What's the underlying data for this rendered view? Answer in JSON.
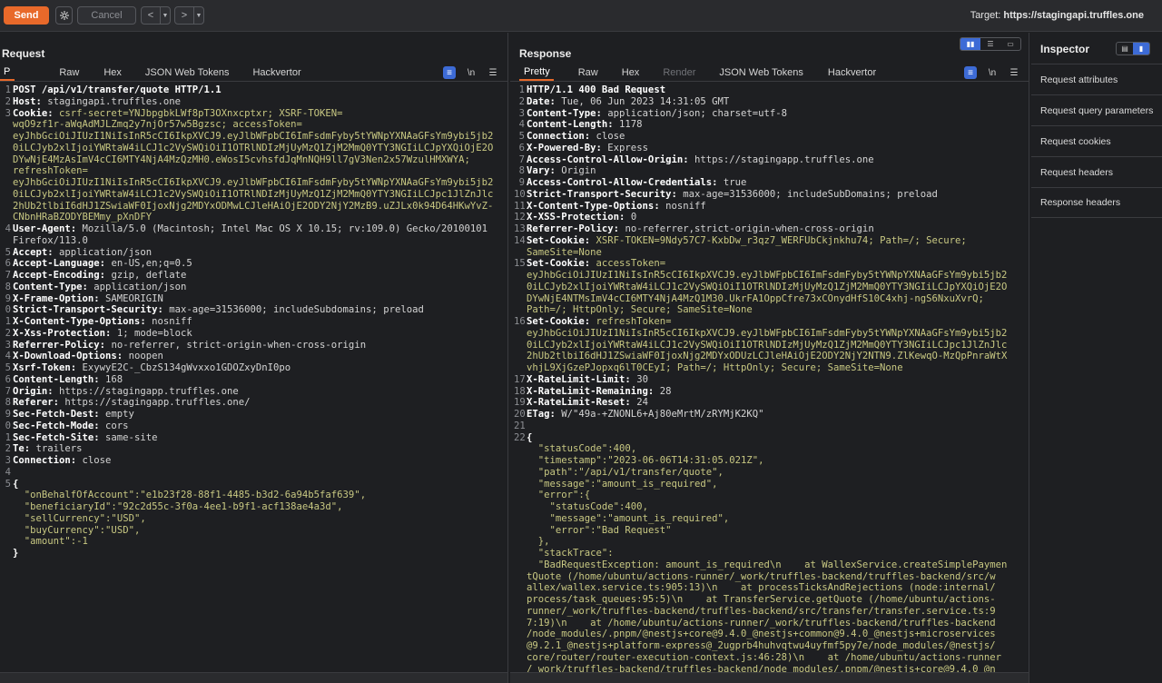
{
  "toolbar": {
    "send_label": "Send",
    "cancel_label": "Cancel",
    "back_label": "<",
    "forward_label": ">",
    "target_prefix": "Target: ",
    "target_url": "https://stagingapi.truffles.one"
  },
  "request": {
    "title": "Request",
    "tabs": [
      "P",
      "Raw",
      "Hex",
      "JSON Web Tokens",
      "Hackvertor"
    ],
    "newline_label": "\\n",
    "lines": [
      {
        "n": "1",
        "t": "POST /api/v1/transfer/quote HTTP/1.1"
      },
      {
        "n": "2",
        "h": "Host:",
        "v": " stagingapi.truffles.one"
      },
      {
        "n": "3",
        "h": "Cookie:",
        "v": " csrf-secret=YNJbpgbkLWf8pT3OXnxcptxr; XSRF-TOKEN=\nwqO9zf1r-aWqAdMJLZmq2y7njOr57w5Bgzsc; accessToken=\neyJhbGciOiJIUzI1NiIsInR5cCI6IkpXVCJ9.eyJlbWFpbCI6ImFsdmFyby5tYWNpYXNAaGFsYm9ybi5jb2\n0iLCJyb2xlIjoiYWRtaW4iLCJ1c2VySWQiOiI1OTRlNDIzMjUyMzQ1ZjM2MmQ0YTY3NGIiLCJpYXQiOjE2O\nDYwNjE4MzAsImV4cCI6MTY4NjA4MzQzMH0.eWosI5cvhsfdJqMnNQH9ll7gV3Nen2x57WzulHMXWYA;\nrefreshToken=\neyJhbGciOiJIUzI1NiIsInR5cCI6IkpXVCJ9.eyJlbWFpbCI6ImFsdmFyby5tYWNpYXNAaGFsYm9ybi5jb2\n0iLCJyb2xlIjoiYWRtaW4iLCJ1c2VySWQiOiI1OTRlNDIzMjUyMzQ1ZjM2MmQ0YTY3NGIiLCJpc1JlZnJlc\n2hUb2tlbiI6dHJ1ZSwiaWF0IjoxNjg2MDYxODMwLCJleHAiOjE2ODY2NjY2MzB9.uZJLx0k94D64HKwYvZ-\nCNbnHRaBZODYBEMmy_pXnDFY"
      },
      {
        "n": "4",
        "h": "User-Agent:",
        "v": " Mozilla/5.0 (Macintosh; Intel Mac OS X 10.15; rv:109.0) Gecko/20100101\nFirefox/113.0"
      },
      {
        "n": "5",
        "h": "Accept:",
        "v": " application/json"
      },
      {
        "n": "6",
        "h": "Accept-Language:",
        "v": " en-US,en;q=0.5"
      },
      {
        "n": "7",
        "h": "Accept-Encoding:",
        "v": " gzip, deflate"
      },
      {
        "n": "8",
        "h": "Content-Type:",
        "v": " application/json"
      },
      {
        "n": "9",
        "h": "X-Frame-Option:",
        "v": " SAMEORIGIN"
      },
      {
        "n": "0",
        "h": "Strict-Transport-Security:",
        "v": " max-age=31536000; includeSubdomains; preload"
      },
      {
        "n": "1",
        "h": "X-Content-Type-Options:",
        "v": " nosniff"
      },
      {
        "n": "2",
        "h": "X-Xss-Protection:",
        "v": " 1; mode=block"
      },
      {
        "n": "3",
        "h": "Referrer-Policy:",
        "v": " no-referrer, strict-origin-when-cross-origin"
      },
      {
        "n": "4",
        "h": "X-Download-Options:",
        "v": " noopen"
      },
      {
        "n": "5",
        "h": "Xsrf-Token:",
        "v": " ExywyE2C-_CbzS134gWvxxo1GDOZxyDnI0po"
      },
      {
        "n": "6",
        "h": "Content-Length:",
        "v": " 168"
      },
      {
        "n": "7",
        "h": "Origin:",
        "v": " https://stagingapp.truffles.one"
      },
      {
        "n": "8",
        "h": "Referer:",
        "v": " https://stagingapp.truffles.one/"
      },
      {
        "n": "9",
        "h": "Sec-Fetch-Dest:",
        "v": " empty"
      },
      {
        "n": "0",
        "h": "Sec-Fetch-Mode:",
        "v": " cors"
      },
      {
        "n": "1",
        "h": "Sec-Fetch-Site:",
        "v": " same-site"
      },
      {
        "n": "2",
        "h": "Te:",
        "v": " trailers"
      },
      {
        "n": "3",
        "h": "Connection:",
        "v": " close"
      },
      {
        "n": "4",
        "t": ""
      },
      {
        "n": "5",
        "t": "{"
      },
      {
        "n": "",
        "j": "  \"onBehalfOfAccount\":\"e1b23f28-88f1-4485-b3d2-6a94b5faf639\","
      },
      {
        "n": "",
        "j": "  \"beneficiaryId\":\"92c2d55c-3f0a-4ee1-b9f1-acf138ae4a3d\","
      },
      {
        "n": "",
        "j": "  \"sellCurrency\":\"USD\","
      },
      {
        "n": "",
        "j": "  \"buyCurrency\":\"USD\","
      },
      {
        "n": "",
        "j": "  \"amount\":-1"
      },
      {
        "n": "",
        "t": "}"
      }
    ]
  },
  "response": {
    "title": "Response",
    "tabs": [
      "Pretty",
      "Raw",
      "Hex",
      "Render",
      "JSON Web Tokens",
      "Hackvertor"
    ],
    "newline_label": "\\n",
    "lines": [
      {
        "n": "1",
        "t": "HTTP/1.1 400 Bad Request"
      },
      {
        "n": "2",
        "h": "Date:",
        "v": " Tue, 06 Jun 2023 14:31:05 GMT"
      },
      {
        "n": "3",
        "h": "Content-Type:",
        "v": " application/json; charset=utf-8"
      },
      {
        "n": "4",
        "h": "Content-Length:",
        "v": " 1178"
      },
      {
        "n": "5",
        "h": "Connection:",
        "v": " close"
      },
      {
        "n": "6",
        "h": "X-Powered-By:",
        "v": " Express"
      },
      {
        "n": "7",
        "h": "Access-Control-Allow-Origin:",
        "v": " https://stagingapp.truffles.one"
      },
      {
        "n": "8",
        "h": "Vary:",
        "v": " Origin"
      },
      {
        "n": "9",
        "h": "Access-Control-Allow-Credentials:",
        "v": " true"
      },
      {
        "n": "10",
        "h": "Strict-Transport-Security:",
        "v": " max-age=31536000; includeSubDomains; preload"
      },
      {
        "n": "11",
        "h": "X-Content-Type-Options:",
        "v": " nosniff"
      },
      {
        "n": "12",
        "h": "X-XSS-Protection:",
        "v": " 0"
      },
      {
        "n": "13",
        "h": "Referrer-Policy:",
        "v": " no-referrer,strict-origin-when-cross-origin"
      },
      {
        "n": "14",
        "h": "Set-Cookie:",
        "v": " XSRF-TOKEN=9Ndy57C7-KxbDw_r3qz7_WERFUbCkjnkhu74; Path=/; Secure;\nSameSite=None"
      },
      {
        "n": "15",
        "h": "Set-Cookie:",
        "v": " accessToken=\neyJhbGciOiJIUzI1NiIsInR5cCI6IkpXVCJ9.eyJlbWFpbCI6ImFsdmFyby5tYWNpYXNAaGFsYm9ybi5jb2\n0iLCJyb2xlIjoiYWRtaW4iLCJ1c2VySWQiOiI1OTRlNDIzMjUyMzQ1ZjM2MmQ0YTY3NGIiLCJpYXQiOjE2O\nDYwNjE4NTMsImV4cCI6MTY4NjA4MzQ1M30.UkrFA1OppCfre73xCOnydHfS10C4xhj-ngS6NxuXvrQ;\nPath=/; HttpOnly; Secure; SameSite=None"
      },
      {
        "n": "16",
        "h": "Set-Cookie:",
        "v": " refreshToken=\neyJhbGciOiJIUzI1NiIsInR5cCI6IkpXVCJ9.eyJlbWFpbCI6ImFsdmFyby5tYWNpYXNAaGFsYm9ybi5jb2\n0iLCJyb2xlIjoiYWRtaW4iLCJ1c2VySWQiOiI1OTRlNDIzMjUyMzQ1ZjM2MmQ0YTY3NGIiLCJpc1JlZnJlc\n2hUb2tlbiI6dHJ1ZSwiaWF0IjoxNjg2MDYxODUzLCJleHAiOjE2ODY2NjY2NTN9.ZlKewqO-MzQpPnraWtX\nvhjL9XjGzePJopxq6lT0CEyI; Path=/; HttpOnly; Secure; SameSite=None"
      },
      {
        "n": "17",
        "h": "X-RateLimit-Limit:",
        "v": " 30"
      },
      {
        "n": "18",
        "h": "X-RateLimit-Remaining:",
        "v": " 28"
      },
      {
        "n": "19",
        "h": "X-RateLimit-Reset:",
        "v": " 24"
      },
      {
        "n": "20",
        "h": "ETag:",
        "v": " W/\"49a-+ZNONL6+Aj80eMrtM/zRYMjK2KQ\""
      },
      {
        "n": "21",
        "t": ""
      },
      {
        "n": "22",
        "t": "{"
      },
      {
        "n": "",
        "j": "  \"statusCode\":400,"
      },
      {
        "n": "",
        "j": "  \"timestamp\":\"2023-06-06T14:31:05.021Z\","
      },
      {
        "n": "",
        "j": "  \"path\":\"/api/v1/transfer/quote\","
      },
      {
        "n": "",
        "j": "  \"message\":\"amount_is_required\","
      },
      {
        "n": "",
        "j": "  \"error\":{"
      },
      {
        "n": "",
        "j": "    \"statusCode\":400,"
      },
      {
        "n": "",
        "j": "    \"message\":\"amount_is_required\","
      },
      {
        "n": "",
        "j": "    \"error\":\"Bad Request\""
      },
      {
        "n": "",
        "j": "  },"
      },
      {
        "n": "",
        "j": "  \"stackTrace\":"
      },
      {
        "n": "",
        "s": "  \"BadRequestException: amount_is_required\\n    at WallexService.createSimplePaymen\ntQuote (/home/ubuntu/actions-runner/_work/truffles-backend/truffles-backend/src/w\nallex/wallex.service.ts:905:13)\\n    at processTicksAndRejections (node:internal/\nprocess/task_queues:95:5)\\n    at TransferService.getQuote (/home/ubuntu/actions-\nrunner/_work/truffles-backend/truffles-backend/src/transfer/transfer.service.ts:9\n7:19)\\n    at /home/ubuntu/actions-runner/_work/truffles-backend/truffles-backend\n/node_modules/.pnpm/@nestjs+core@9.4.0_@nestjs+common@9.4.0_@nestjs+microservices\n@9.2.1_@nestjs+platform-express@_2ugprb4huhvqtwu4uyfmf5py7e/node_modules/@nestjs/\ncore/router/router-execution-context.js:46:28)\\n    at /home/ubuntu/actions-runner\n/_work/truffles-backend/truffles-backend/node_modules/.pnpm/@nestjs+core@9.4.0_@n"
      }
    ]
  },
  "inspector": {
    "title": "Inspector",
    "items": [
      "Request attributes",
      "Request query parameters",
      "Request cookies",
      "Request headers",
      "Response headers"
    ]
  }
}
